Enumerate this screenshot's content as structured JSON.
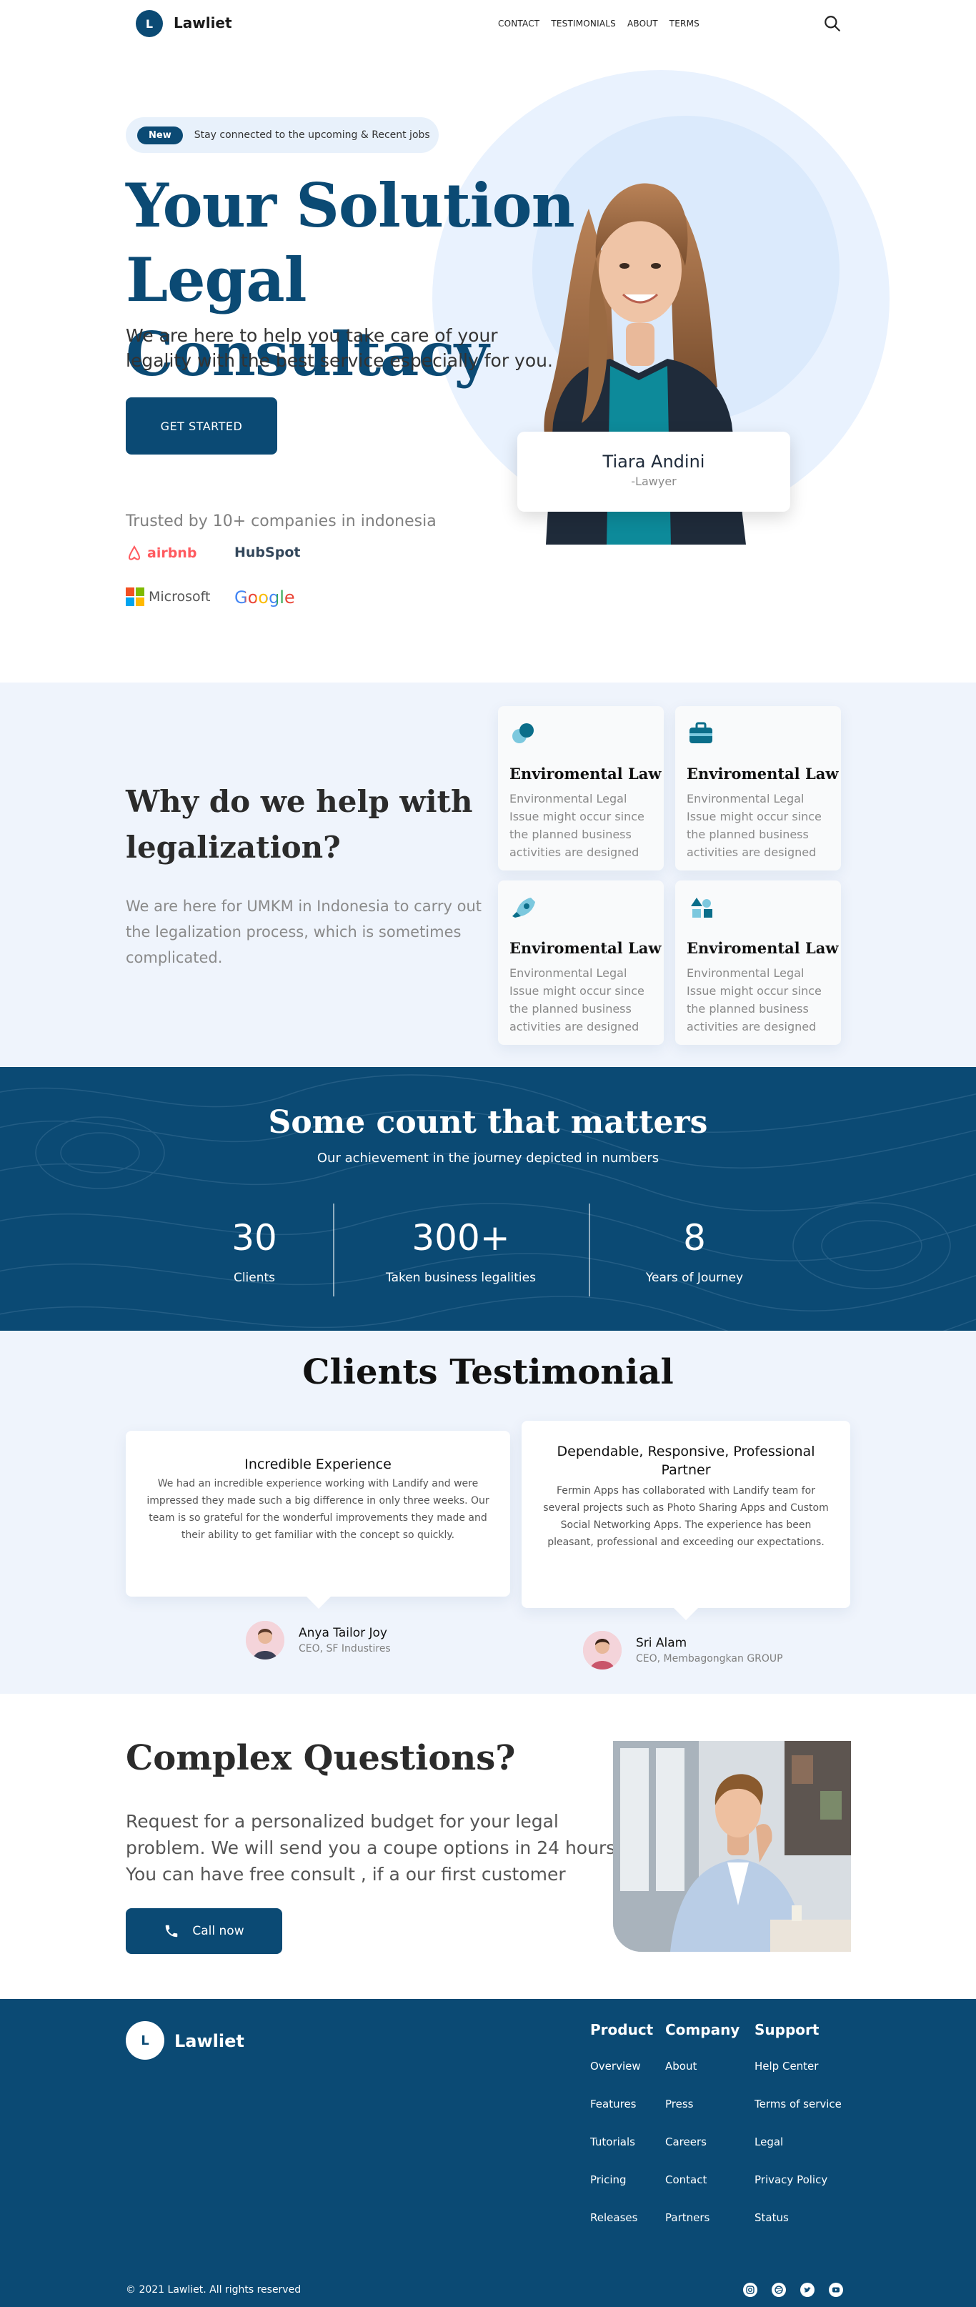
{
  "nav": {
    "logo_letter": "L",
    "brand": "Lawliet",
    "links": [
      "CONTACT",
      "TESTIMONIALS",
      "ABOUT",
      "TERMS"
    ]
  },
  "hero": {
    "badge": "New",
    "pill_text": "Stay connected to the upcoming & Recent jobs",
    "title_line1": "Your Solution",
    "title_line2": "Legal Consultacy",
    "subtitle": "We are here to help you take care of your legality with the best service especially for you.",
    "cta": "GET STARTED",
    "person_name": "Tiara Andini",
    "person_role": "-Lawyer",
    "trusted": "Trusted by 10+ companies in indonesia",
    "brands": [
      "airbnb",
      "HubSpot",
      "Microsoft",
      "Google"
    ]
  },
  "why": {
    "title": "Why do we help with legalization?",
    "subtitle": "We are here for UMKM in Indonesia to carry out the legalization process, which is sometimes complicated.",
    "cards": [
      {
        "title": "Enviromental Law",
        "text": "Environmental Legal Issue might occur since the planned business activities are designed",
        "icon": "pills-icon"
      },
      {
        "title": "Enviromental Law",
        "text": "Environmental Legal Issue might occur since the planned business activities are designed",
        "icon": "briefcase-icon"
      },
      {
        "title": "Enviromental Law",
        "text": "Environmental Legal Issue might occur since the planned business activities are designed",
        "icon": "rocket-icon"
      },
      {
        "title": "Enviromental Law",
        "text": "Environmental Legal Issue might occur since the planned business activities are designed",
        "icon": "shapes-icon"
      }
    ]
  },
  "count": {
    "title": "Some count that matters",
    "subtitle": "Our achievement in the journey depicted in numbers",
    "stats": [
      {
        "value": "30",
        "label": "Clients"
      },
      {
        "value": "300+",
        "label": "Taken business legalities"
      },
      {
        "value": "8",
        "label": "Years of Journey"
      }
    ]
  },
  "testimonials": {
    "title": "Clients Testimonial",
    "items": [
      {
        "heading": "Incredible Experience",
        "text": "We had an incredible experience working with Landify and were impressed they made such a big difference in only three weeks. Our team is so grateful for the wonderful improvements they made and their ability to get familiar with the concept so quickly.",
        "name": "Anya Tailor Joy",
        "role": "CEO, SF Industires"
      },
      {
        "heading": "Dependable, Responsive, Professional Partner",
        "text": "Fermin Apps has collaborated with Landify team for several projects such as Photo Sharing Apps and Custom Social Networking Apps. The experience has been pleasant, professional and exceeding our expectations.",
        "name": "Sri Alam",
        "role": "CEO, Membagongkan GROUP"
      }
    ]
  },
  "complex": {
    "title": "Complex Questions?",
    "subtitle": "Request for a personalized budget for your legal problem. We will send you a coupe options in 24 hours. You can have free consult , if a our first customer",
    "cta": "Call now"
  },
  "footer": {
    "logo_letter": "L",
    "brand": "Lawliet",
    "columns": [
      {
        "title": "Product",
        "links": [
          "Overview",
          "Features",
          "Tutorials",
          "Pricing",
          "Releases"
        ]
      },
      {
        "title": "Company",
        "links": [
          "About",
          "Press",
          "Careers",
          "Contact",
          "Partners"
        ]
      },
      {
        "title": "Support",
        "links": [
          "Help Center",
          "Terms of service",
          "Legal",
          "Privacy Policy",
          "Status"
        ]
      }
    ],
    "copyright": "© 2021 Lawliet. All rights reserved",
    "social": [
      "instagram-icon",
      "dribbble-icon",
      "twitter-icon",
      "youtube-icon"
    ]
  },
  "colors": {
    "primary": "#0b4a74",
    "light_bg": "#eff4fc"
  }
}
